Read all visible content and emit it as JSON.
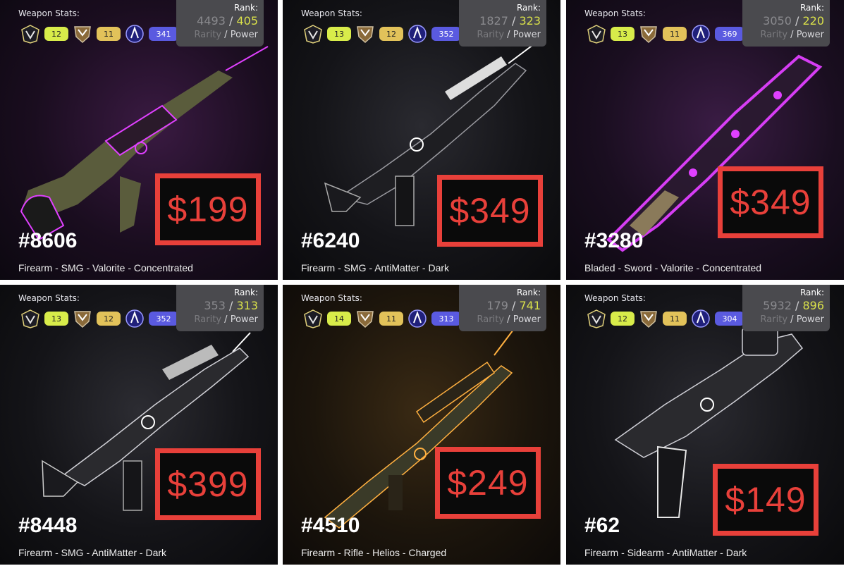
{
  "cards": [
    {
      "stats_label": "Weapon Stats:",
      "stat1": "12",
      "stat2": "11",
      "stat3": "341",
      "rank_label": "Rank:",
      "rarity_value": "4493",
      "power_value": "405",
      "rarity_label": "Rarity",
      "power_label": "Power",
      "id": "#8606",
      "description": "Firearm - SMG - Valorite - Concentrated",
      "price": "$199",
      "glow": "#e040ff"
    },
    {
      "stats_label": "Weapon Stats:",
      "stat1": "13",
      "stat2": "12",
      "stat3": "352",
      "rank_label": "Rank:",
      "rarity_value": "1827",
      "power_value": "323",
      "rarity_label": "Rarity",
      "power_label": "Power",
      "id": "#6240",
      "description": "Firearm - SMG - AntiMatter - Dark",
      "price": "$349",
      "glow": "#ffffff"
    },
    {
      "stats_label": "Weapon Stats:",
      "stat1": "13",
      "stat2": "11",
      "stat3": "369",
      "rank_label": "Rank:",
      "rarity_value": "3050",
      "power_value": "220",
      "rarity_label": "Rarity",
      "power_label": "Power",
      "id": "#3280",
      "description": "Bladed - Sword - Valorite - Concentrated",
      "price": "$349",
      "glow": "#e040ff"
    },
    {
      "stats_label": "Weapon Stats:",
      "stat1": "13",
      "stat2": "12",
      "stat3": "352",
      "rank_label": "Rank:",
      "rarity_value": "353",
      "power_value": "313",
      "rarity_label": "Rarity",
      "power_label": "Power",
      "id": "#8448",
      "description": "Firearm - SMG - AntiMatter - Dark",
      "price": "$399",
      "glow": "#ffffff"
    },
    {
      "stats_label": "Weapon Stats:",
      "stat1": "14",
      "stat2": "11",
      "stat3": "313",
      "rank_label": "Rank:",
      "rarity_value": "179",
      "power_value": "741",
      "rarity_label": "Rarity",
      "power_label": "Power",
      "id": "#4510",
      "description": "Firearm - Rifle - Helios - Charged",
      "price": "$249",
      "glow": "#ffb040"
    },
    {
      "stats_label": "Weapon Stats:",
      "stat1": "12",
      "stat2": "11",
      "stat3": "304",
      "rank_label": "Rank:",
      "rarity_value": "5932",
      "power_value": "896",
      "rarity_label": "Rarity",
      "power_label": "Power",
      "id": "#62",
      "description": "Firearm - Sidearm - AntiMatter - Dark",
      "price": "$149",
      "glow": "#ffffff"
    }
  ],
  "colors": {
    "price_red": "#e8403a",
    "power_yellow": "#d9e04a",
    "pill_green": "#d8ec4a",
    "pill_gold": "#e2c25a",
    "pill_blue": "#5a5ae0",
    "rank_box": "#4a4a4e"
  }
}
